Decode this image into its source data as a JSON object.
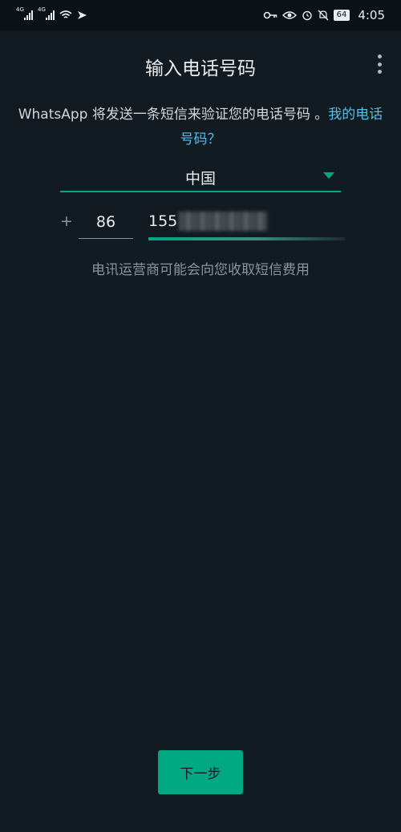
{
  "status_bar": {
    "signal_1_label": "4G",
    "signal_2_label": "4G",
    "battery": "64",
    "time": "4:05"
  },
  "header": {
    "title": "输入电话号码",
    "menu_icon": "more-vert-icon"
  },
  "description": {
    "text": "WhatsApp 将发送一条短信来验证您的电话号码 。",
    "link": "我的电话号码？"
  },
  "country": {
    "selected": "中国"
  },
  "phone": {
    "plus": "+",
    "country_code": "86",
    "number_visible": "155"
  },
  "hint": "电讯运营商可能会向您收取短信费用",
  "next_button": "下一步",
  "colors": {
    "background": "#121b22",
    "accent": "#00a884",
    "link": "#53bdeb"
  }
}
